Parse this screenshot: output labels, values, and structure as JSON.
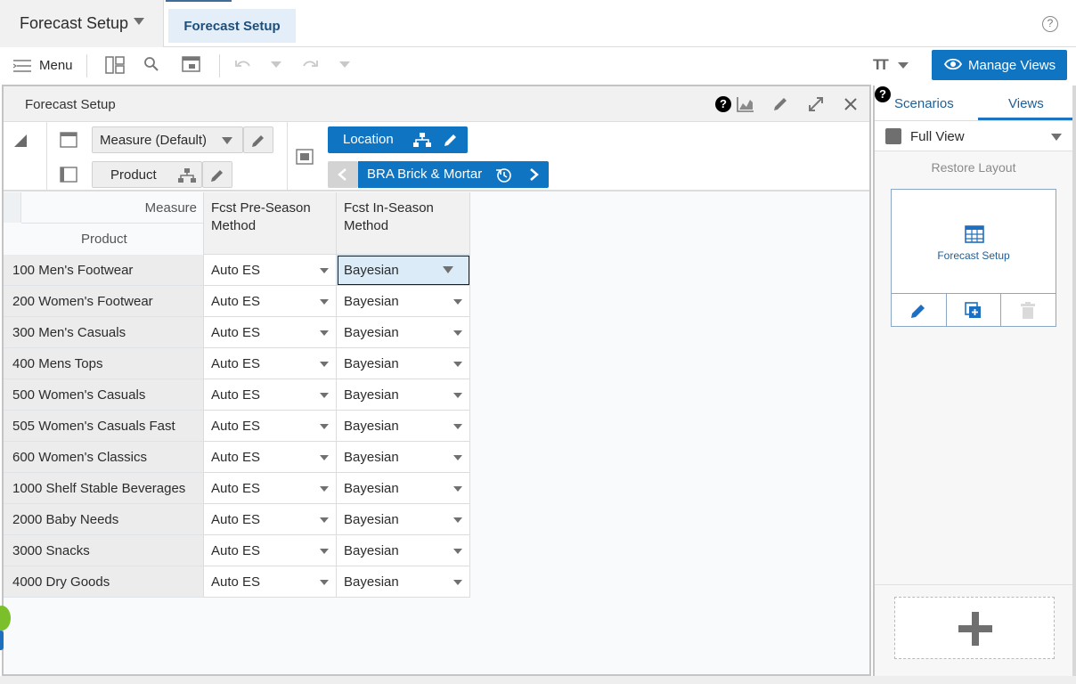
{
  "app": {
    "title": "Forecast Setup",
    "active_tab": "Forecast Setup",
    "help_glyph": "?"
  },
  "toolbar": {
    "menu_label": "Menu",
    "manage_views_label": "Manage Views",
    "text_size_label": "TT"
  },
  "panel": {
    "title": "Forecast Setup",
    "help_glyph": "?"
  },
  "pivot": {
    "measure_selector": "Measure (Default)",
    "product_label": "Product",
    "location_label": "Location",
    "location_value": "BRA Brick & Mortar"
  },
  "grid": {
    "corner_measure": "Measure",
    "corner_product": "Product",
    "columns": [
      "Fcst Pre-Season Method",
      "Fcst In-Season Method"
    ],
    "rows": [
      {
        "product": "100 Men's Footwear",
        "pre": "Auto ES",
        "in": "Bayesian",
        "selected": true
      },
      {
        "product": "200 Women's Footwear",
        "pre": "Auto ES",
        "in": "Bayesian"
      },
      {
        "product": "300 Men's Casuals",
        "pre": "Auto ES",
        "in": "Bayesian"
      },
      {
        "product": "400 Mens Tops",
        "pre": "Auto ES",
        "in": "Bayesian"
      },
      {
        "product": "500 Women's Casuals",
        "pre": "Auto ES",
        "in": "Bayesian"
      },
      {
        "product": "505 Women's Casuals Fast",
        "pre": "Auto ES",
        "in": "Bayesian"
      },
      {
        "product": "600 Women's Classics",
        "pre": "Auto ES",
        "in": "Bayesian"
      },
      {
        "product": "1000 Shelf Stable Beverages",
        "pre": "Auto ES",
        "in": "Bayesian"
      },
      {
        "product": "2000 Baby Needs",
        "pre": "Auto ES",
        "in": "Bayesian"
      },
      {
        "product": "3000 Snacks",
        "pre": "Auto ES",
        "in": "Bayesian"
      },
      {
        "product": "4000 Dry Goods",
        "pre": "Auto ES",
        "in": "Bayesian"
      }
    ]
  },
  "right_panel": {
    "tabs": [
      "Scenarios",
      "Views"
    ],
    "active_tab": "Views",
    "view_select": "Full View",
    "restore_layout": "Restore Layout",
    "view_card_label": "Forecast Setup",
    "help_glyph": "?"
  },
  "colors": {
    "accent": "#0f74c2",
    "tab_active_bg": "#e3eef8",
    "selected_cell_bg": "#dcebf8"
  }
}
